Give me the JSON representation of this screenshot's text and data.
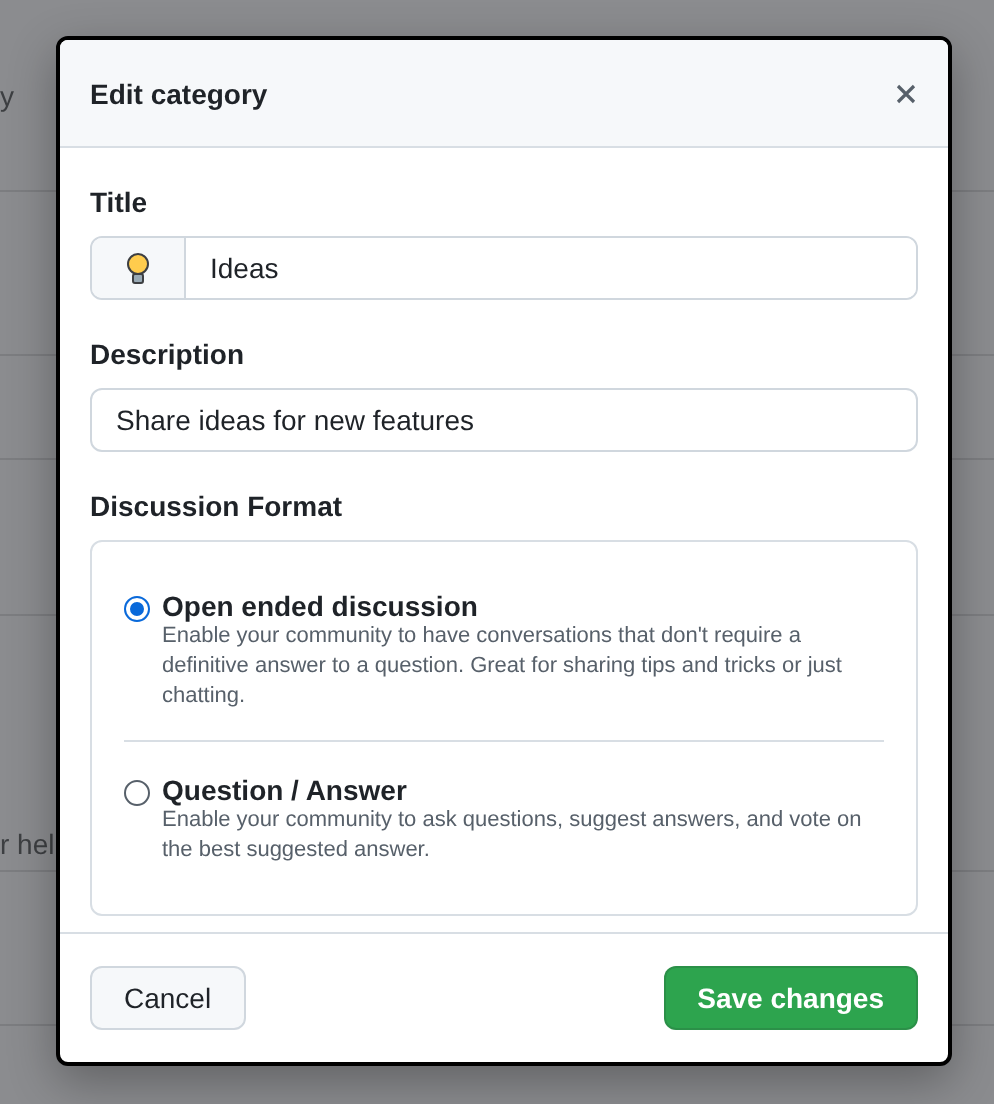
{
  "backdrop": {
    "fragments": [
      "y",
      "r hel"
    ]
  },
  "dialog": {
    "title": "Edit category",
    "title_field": {
      "label": "Title",
      "value": "Ideas"
    },
    "description_field": {
      "label": "Description",
      "value": "Share ideas for new features"
    },
    "format": {
      "label": "Discussion Format",
      "options": [
        {
          "title": "Open ended discussion",
          "description": "Enable your community to have conversations that don't require a definitive answer to a question. Great for sharing tips and tricks or just chatting.",
          "selected": true
        },
        {
          "title": "Question / Answer",
          "description": "Enable your community to ask questions, suggest answers, and vote on the best suggested answer.",
          "selected": false
        }
      ]
    },
    "buttons": {
      "cancel": "Cancel",
      "save": "Save changes"
    }
  }
}
